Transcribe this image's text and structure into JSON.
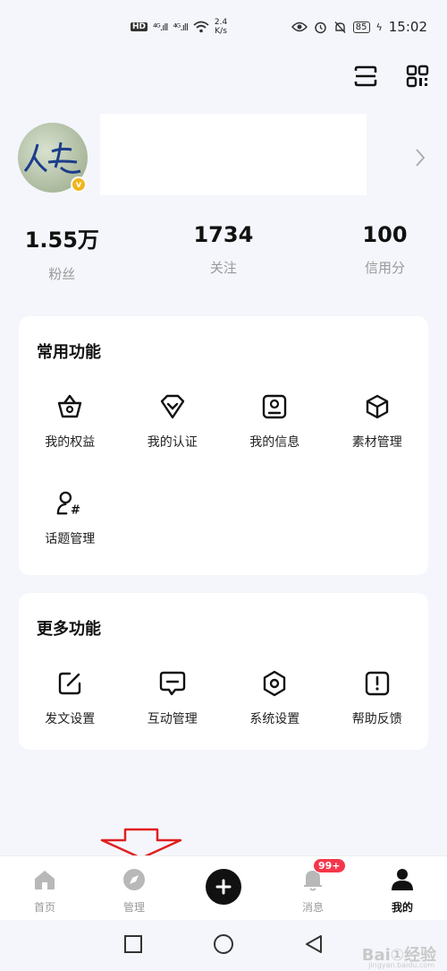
{
  "status_bar": {
    "hd": "HD",
    "signal_1": "⁴ᴳ.ıll",
    "signal_2": "⁴ᴳ.ıll",
    "netspeed_value": "2.4",
    "netspeed_unit": "K/s",
    "battery": "85",
    "time": "15:02"
  },
  "header_icons": [
    "scan-icon",
    "qr-code-icon"
  ],
  "profile": {
    "verified_mark": "v"
  },
  "stats": [
    {
      "value": "1.55万",
      "label": "粉丝"
    },
    {
      "value": "1734",
      "label": "关注"
    },
    {
      "value": "100",
      "label": "信用分"
    }
  ],
  "common": {
    "title": "常用功能",
    "items": [
      {
        "label": "我的权益",
        "icon": "basket-icon"
      },
      {
        "label": "我的认证",
        "icon": "verified-heart-icon"
      },
      {
        "label": "我的信息",
        "icon": "user-card-icon"
      },
      {
        "label": "素材管理",
        "icon": "cube-icon"
      },
      {
        "label": "话题管理",
        "icon": "topic-icon"
      }
    ]
  },
  "more": {
    "title": "更多功能",
    "items": [
      {
        "label": "发文设置",
        "icon": "edit-icon"
      },
      {
        "label": "互动管理",
        "icon": "message-icon"
      },
      {
        "label": "系统设置",
        "icon": "settings-icon"
      },
      {
        "label": "帮助反馈",
        "icon": "alert-icon"
      }
    ]
  },
  "tabbar": {
    "tabs": [
      {
        "label": "首页",
        "icon": "home-icon"
      },
      {
        "label": "管理",
        "icon": "compass-icon"
      },
      {
        "label": "",
        "icon": "plus-icon"
      },
      {
        "label": "消息",
        "icon": "bell-icon",
        "badge": "99+"
      },
      {
        "label": "我的",
        "icon": "user-icon",
        "active": true
      }
    ]
  },
  "watermark": {
    "text": "Bai①经验",
    "sub": "jingyan.baidu.com"
  },
  "colors": {
    "background": "#f4f6fb",
    "badge": "#f5364a",
    "verified": "#f2b51f",
    "annotation_arrow": "#e02020"
  }
}
